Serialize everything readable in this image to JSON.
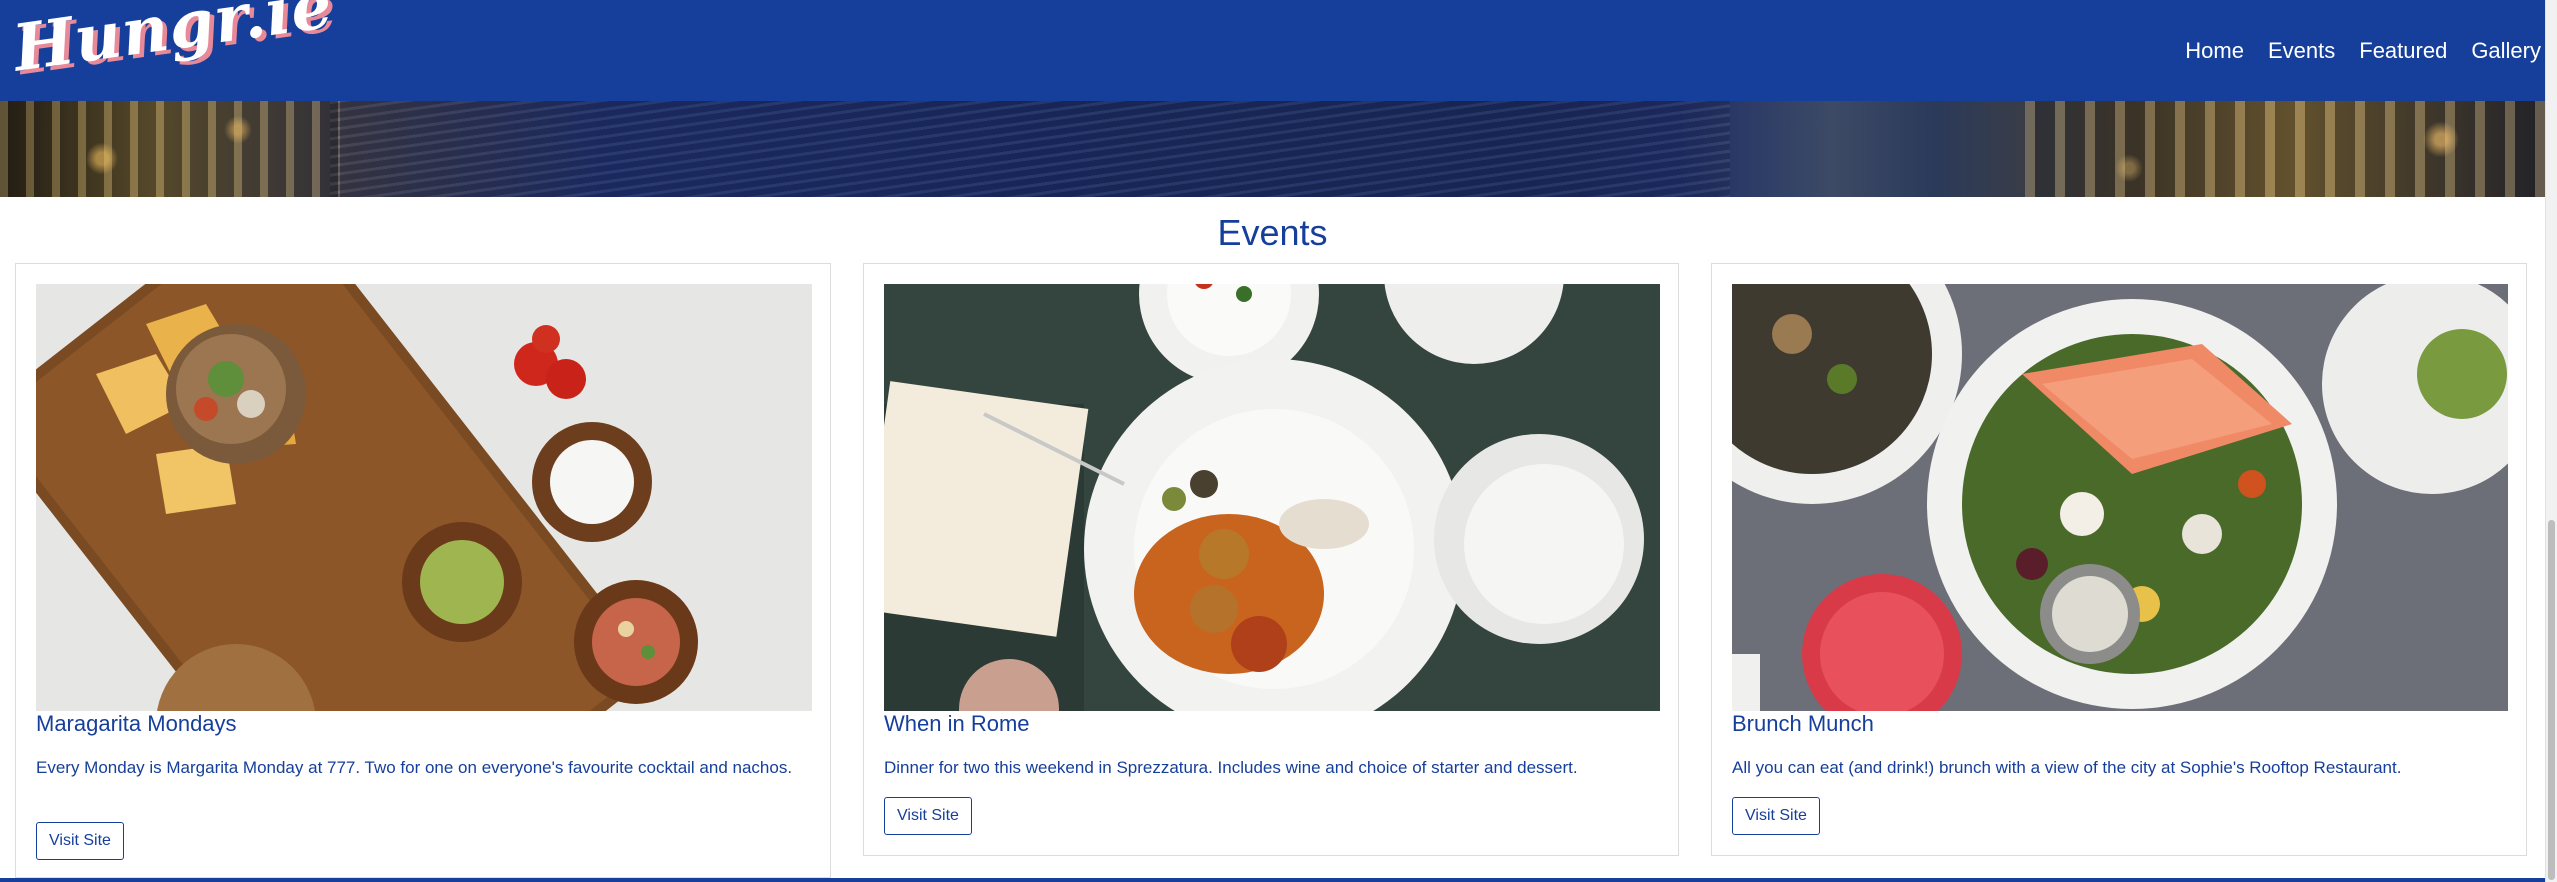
{
  "nav": {
    "logo_text": "Hungr.ie",
    "links": [
      "Home",
      "Events",
      "Featured",
      "Gallery"
    ]
  },
  "section": {
    "title": "Events"
  },
  "cards": [
    {
      "title": "Maragarita Mondays",
      "text": "Every Monday is Margarita Monday at 777. Two for one on everyone's favourite cocktail and nachos.",
      "button": "Visit Site",
      "image": "nachos-board-image"
    },
    {
      "title": "When in Rome",
      "text": "Dinner for two this weekend in Sprezzatura. Includes wine and choice of starter and dessert.",
      "button": "Visit Site",
      "image": "italian-dinner-image"
    },
    {
      "title": "Brunch Munch",
      "text": "All you can eat (and drink!) brunch with a view of the city at Sophie's Rooftop Restaurant.",
      "button": "Visit Site",
      "image": "salmon-salad-image"
    }
  ],
  "colors": {
    "brand_blue": "#163f9b",
    "logo_shadow": "#e8899a",
    "background": "#ffffff"
  }
}
